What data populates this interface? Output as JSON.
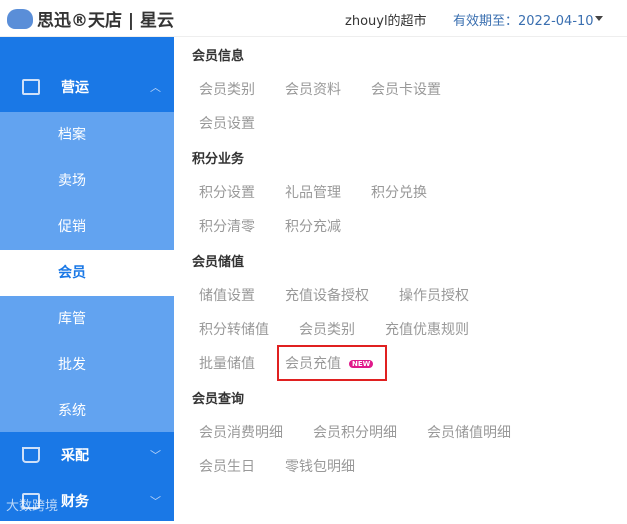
{
  "header": {
    "logo": "思迅®天店 | 星云",
    "store": "zhouyl的超市",
    "expire_label": "有效期至：",
    "expire_date": "2022-04-10"
  },
  "sidebar": {
    "groups": [
      {
        "label": "营运",
        "chevron": "^",
        "icon": "chart-icon"
      },
      {
        "label": "采配",
        "chevron": "v",
        "icon": "cart-icon"
      },
      {
        "label": "财务",
        "chevron": "v",
        "icon": "finance-icon"
      }
    ],
    "subitems": [
      "档案",
      "卖场",
      "促销",
      "会员",
      "库管",
      "批发",
      "系统"
    ],
    "active": "会员"
  },
  "content": {
    "sections": [
      {
        "title": "会员信息",
        "rows": [
          [
            "会员类别",
            "会员资料",
            "会员卡设置"
          ],
          [
            "会员设置"
          ]
        ]
      },
      {
        "title": "积分业务",
        "rows": [
          [
            "积分设置",
            "礼品管理",
            "积分兑换"
          ],
          [
            "积分清零",
            "积分充减"
          ]
        ]
      },
      {
        "title": "会员储值",
        "rows": [
          [
            "储值设置",
            "充值设备授权",
            "操作员授权"
          ],
          [
            "积分转储值",
            "会员类别",
            "充值优惠规则"
          ],
          [
            "批量储值",
            "会员充值"
          ]
        ]
      },
      {
        "title": "会员查询",
        "rows": [
          [
            "会员消费明细",
            "会员积分明细",
            "会员储值明细"
          ],
          [
            "会员生日",
            "零钱包明细"
          ]
        ]
      }
    ],
    "new_badge": "NEW"
  },
  "watermark": "大数跨境"
}
